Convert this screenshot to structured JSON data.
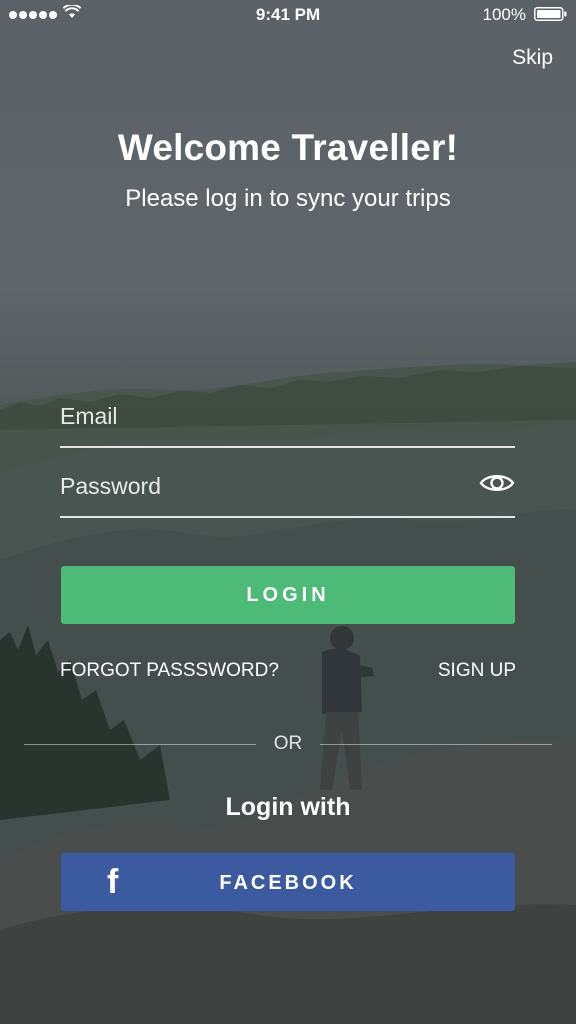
{
  "status_bar": {
    "time": "9:41 PM",
    "battery": "100%"
  },
  "header": {
    "skip_label": "Skip",
    "title": "Welcome Traveller!",
    "subtitle": "Please log in to sync your trips"
  },
  "form": {
    "email_placeholder": "Email",
    "password_placeholder": "Password",
    "login_label": "LOGIN",
    "forgot_label": "FORGOT PASSSWORD?",
    "signup_label": "SIGN UP"
  },
  "divider": {
    "or_label": "OR"
  },
  "social": {
    "login_with_label": "Login with",
    "facebook_label": "FACEBOOK",
    "facebook_icon": "f"
  },
  "colors": {
    "login_button": "#4dba77",
    "facebook_button": "#3b5aa0"
  }
}
